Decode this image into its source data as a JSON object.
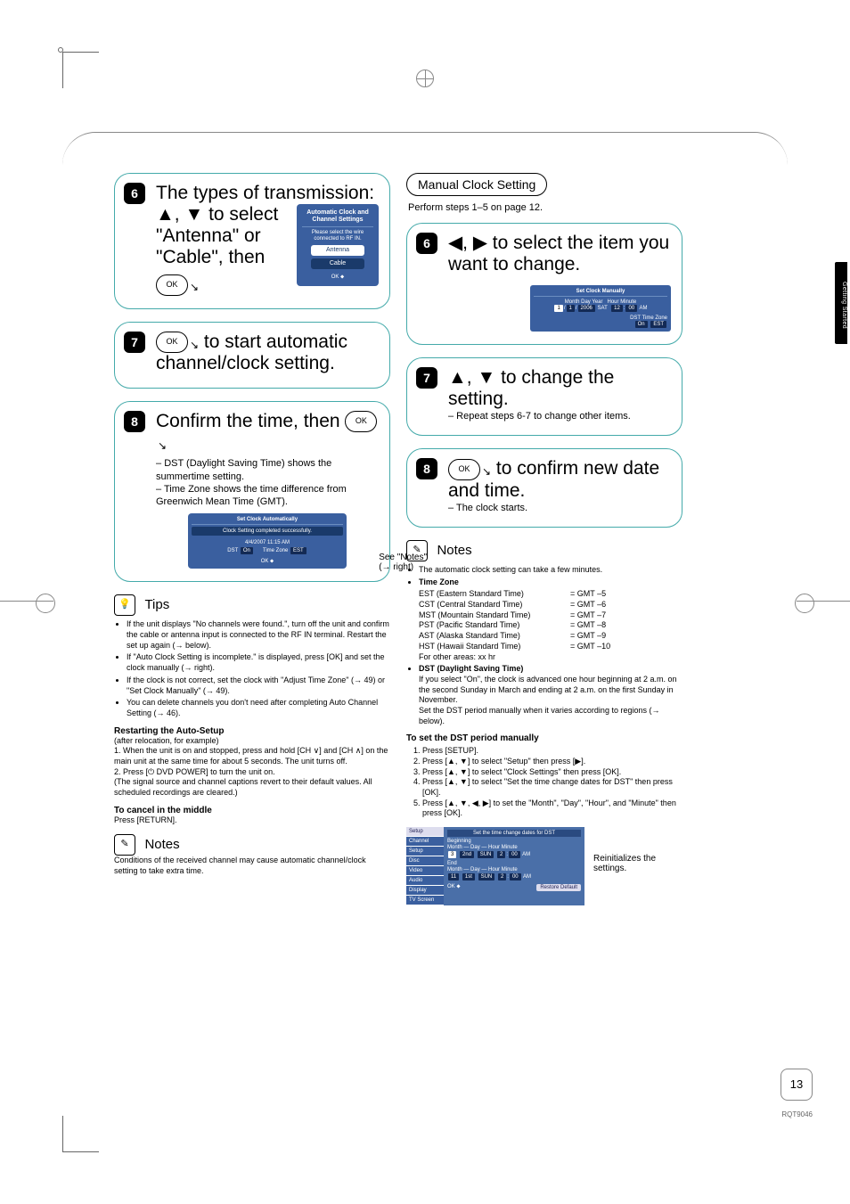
{
  "sidetab": "Getting Started",
  "pagenum": "13",
  "docid": "RQT9046",
  "left": {
    "s6": {
      "lead": "The types of transmission:",
      "body": "▲, ▼ to select \"Antenna\" or \"Cable\", then",
      "win_title": "Automatic Clock and Channel Settings",
      "win_msg": "Please select the wire connected to RF IN.",
      "btn1": "Antenna",
      "btn2": "Cable",
      "ok": "OK"
    },
    "s7": {
      "body": " to start automatic channel/clock setting.",
      "ok": "OK"
    },
    "s8": {
      "lead": "Confirm the time, then ",
      "ok": "OK",
      "b1": "DST (Daylight Saving Time) shows the summertime setting.",
      "b2": "Time Zone shows the time difference from Greenwich Mean Time (GMT).",
      "win_title": "Set Clock Automatically",
      "win_sub": "Clock Setting completed successfully.",
      "win_date": "4/4/2007  11:15 AM",
      "win_dst": "DST",
      "win_dst_v": "On",
      "win_tz": "Time Zone",
      "win_tz_v": "EST",
      "callout1": "See \"Notes\"",
      "callout2": "(→ right)"
    },
    "tips_h": "Tips",
    "tips": [
      "If the unit displays \"No channels were found.\", turn off the unit and confirm the cable or antenna input is connected to the RF IN terminal. Restart the set up again (→ below).",
      "If \"Auto Clock Setting is incomplete.\" is displayed, press [OK] and set the clock manually (→ right).",
      "If the clock is not correct, set the clock with \"Adjust Time Zone\" (→ 49) or \"Set Clock Manually\" (→ 49).",
      "You can delete channels you don't need after completing Auto Channel Setting (→ 46)."
    ],
    "restart_h": "Restarting the Auto-Setup",
    "restart_sub": "(after relocation, for example)",
    "restart_1": "1. When the unit is on and stopped, press and hold [CH ∨] and [CH ∧] on the main unit at the same time for about 5 seconds. The unit turns off.",
    "restart_2": "2. Press [⏻ DVD POWER] to turn the unit on.",
    "restart_note": "(The signal source and channel captions revert to their default values. All scheduled recordings are cleared.)",
    "cancel_h": "To cancel in the middle",
    "cancel_b": "Press [RETURN].",
    "notes_h": "Notes",
    "notes_b": "Conditions of the received channel may cause automatic channel/clock setting to take extra time."
  },
  "right": {
    "pill": "Manual Clock Setting",
    "perform": "Perform steps 1–5 on page 12.",
    "s6": {
      "body": "◀, ▶ to select the item you want to change.",
      "win_title": "Set Clock Manually",
      "labels": {
        "m": "Month",
        "d": "Day",
        "y": "Year",
        "h": "Hour",
        "mi": "Minute",
        "dst": "DST",
        "tz": "Time Zone"
      },
      "vals": {
        "m": "1",
        "d": "1",
        "y": "2006",
        "dow": "SAT",
        "h": "12",
        "mi": "00",
        "ap": "AM",
        "dst": "On",
        "tz": "EST"
      }
    },
    "s7": {
      "body": "▲, ▼ to change the setting.",
      "sub": "– Repeat steps 6-7 to change other items."
    },
    "s8": {
      "body": " to confirm new date and time.",
      "sub": "– The clock starts.",
      "ok": "OK"
    },
    "notes_h": "Notes",
    "note1": "The automatic clock setting can take a few minutes.",
    "tz_h": "Time Zone",
    "tz": [
      {
        "l": "EST (Eastern Standard Time)",
        "r": "= GMT –5"
      },
      {
        "l": "CST (Central Standard Time)",
        "r": "= GMT –6"
      },
      {
        "l": "MST (Mountain Standard Time)",
        "r": "= GMT –7"
      },
      {
        "l": "PST (Pacific Standard Time)",
        "r": "= GMT –8"
      },
      {
        "l": "AST (Alaska Standard Time)",
        "r": "= GMT –9"
      },
      {
        "l": "HST (Hawaii Standard Time)",
        "r": "= GMT –10"
      }
    ],
    "tz_other": "For other areas: xx hr",
    "dst_h": "DST (Daylight Saving Time)",
    "dst_b1": "If you select \"On\", the clock is advanced one hour beginning at 2 a.m. on the second Sunday in March and ending at 2 a.m. on the first Sunday in November.",
    "dst_b2": "Set the DST period manually when it varies according to regions (→ below).",
    "setdst_h": "To set the DST period manually",
    "setdst": [
      "Press [SETUP].",
      "Press [▲, ▼] to select \"Setup\" then press [▶].",
      "Press [▲, ▼] to select \"Clock Settings\" then press [OK].",
      "Press [▲, ▼] to select \"Set the time change dates for DST\" then press [OK].",
      "Press [▲, ▼, ◀, ▶] to set the \"Month\", \"Day\", \"Hour\", and \"Minute\" then press [OK]."
    ],
    "menu": {
      "side": [
        "Setup",
        "Channel",
        "Setup",
        "Disc",
        "Video",
        "Audio",
        "Display",
        "TV Screen"
      ],
      "title": "Set the time change dates for DST",
      "beg": "Beginning",
      "end": "End",
      "labels": {
        "m": "Month",
        "d": "Day",
        "h": "Hour",
        "mi": "Minute"
      },
      "row1": {
        "m": "3",
        "w": "2nd",
        "d": "SUN",
        "h": "2",
        "mi": "00",
        "ap": "AM"
      },
      "row2": {
        "m": "11",
        "w": "1st",
        "d": "SUN",
        "h": "2",
        "mi": "00",
        "ap": "AM"
      },
      "restore": "Restore Default",
      "ok": "OK"
    },
    "reinit": "Reinitializes the settings."
  }
}
